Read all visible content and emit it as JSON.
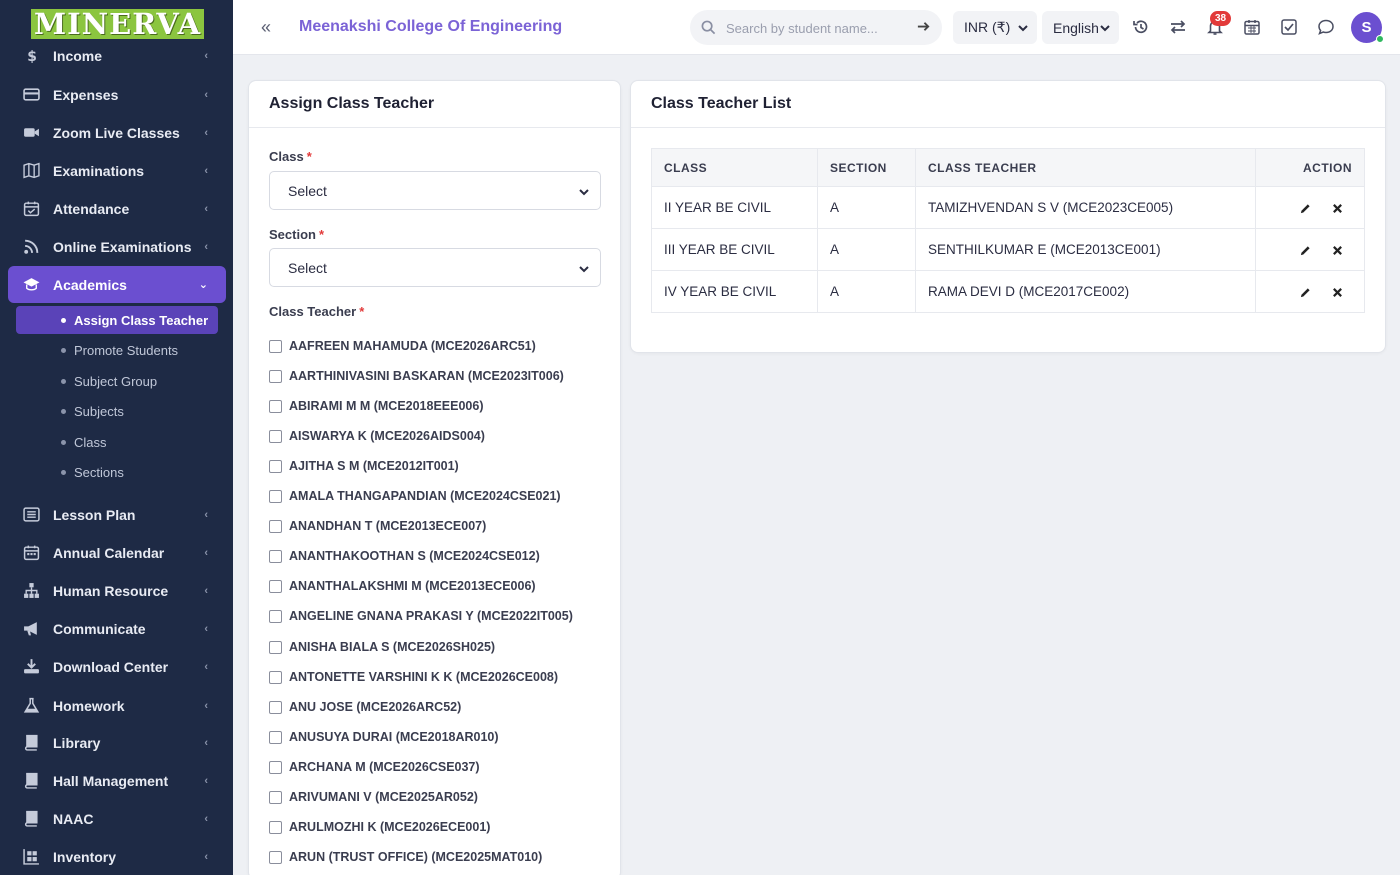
{
  "sidebar": {
    "logo": "MINERVA",
    "items": [
      {
        "label": "Income",
        "icon": "dollar-icon"
      },
      {
        "label": "Expenses",
        "icon": "credit-card-icon"
      },
      {
        "label": "Zoom Live Classes",
        "icon": "video-icon"
      },
      {
        "label": "Examinations",
        "icon": "map-icon"
      },
      {
        "label": "Attendance",
        "icon": "calendar-check-icon"
      },
      {
        "label": "Online Examinations",
        "icon": "rss-icon"
      },
      {
        "label": "Academics",
        "icon": "graduation-cap-icon"
      },
      {
        "label": "Lesson Plan",
        "icon": "list-icon"
      },
      {
        "label": "Annual Calendar",
        "icon": "calendar-icon"
      },
      {
        "label": "Human Resource",
        "icon": "sitemap-icon"
      },
      {
        "label": "Communicate",
        "icon": "bullhorn-icon"
      },
      {
        "label": "Download Center",
        "icon": "download-icon"
      },
      {
        "label": "Homework",
        "icon": "flask-icon"
      },
      {
        "label": "Library",
        "icon": "book-icon"
      },
      {
        "label": "Hall Management",
        "icon": "book-open-icon"
      },
      {
        "label": "NAAC",
        "icon": "book-icon"
      },
      {
        "label": "Inventory",
        "icon": "boxes-icon"
      }
    ],
    "academics_sub": [
      {
        "label": "Assign Class Teacher",
        "active": true
      },
      {
        "label": "Promote Students"
      },
      {
        "label": "Subject Group"
      },
      {
        "label": "Subjects"
      },
      {
        "label": "Class"
      },
      {
        "label": "Sections"
      }
    ]
  },
  "header": {
    "college": "Meenakshi College Of Engineering",
    "search_placeholder": "Search by student name...",
    "currency": "INR (₹)",
    "language": "English",
    "notification_count": "38",
    "avatar": "S"
  },
  "assign_form": {
    "title": "Assign Class Teacher",
    "class_label": "Class",
    "class_value": "Select",
    "section_label": "Section",
    "section_value": "Select",
    "teacher_label": "Class Teacher",
    "required_mark": "*",
    "teachers": [
      "AAFREEN MAHAMUDA (MCE2026ARC51)",
      "AARTHINIVASINI BASKARAN (MCE2023IT006)",
      "ABIRAMI M M (MCE2018EEE006)",
      "AISWARYA K (MCE2026AIDS004)",
      "AJITHA S M (MCE2012IT001)",
      "AMALA THANGAPANDIAN (MCE2024CSE021)",
      "ANANDHAN T (MCE2013ECE007)",
      "ANANTHAKOOTHAN S (MCE2024CSE012)",
      "ANANTHALAKSHMI M (MCE2013ECE006)",
      "ANGELINE GNANA PRAKASI Y (MCE2022IT005)",
      "ANISHA BIALA S (MCE2026SH025)",
      "ANTONETTE VARSHINI K K (MCE2026CE008)",
      "ANU JOSE (MCE2026ARC52)",
      "ANUSUYA DURAI (MCE2018AR010)",
      "ARCHANA M (MCE2026CSE037)",
      "ARIVUMANI V (MCE2025AR052)",
      "ARULMOZHI K (MCE2026ECE001)",
      "ARUN (TRUST OFFICE) (MCE2025MAT010)"
    ]
  },
  "teacher_list": {
    "title": "Class Teacher List",
    "columns": [
      "CLASS",
      "SECTION",
      "CLASS TEACHER",
      "ACTION"
    ],
    "rows": [
      {
        "class": "II YEAR BE CIVIL",
        "section": "A",
        "teacher": "TAMIZHVENDAN S V (MCE2023CE005)"
      },
      {
        "class": "III YEAR BE CIVIL",
        "section": "A",
        "teacher": "SENTHILKUMAR E (MCE2013CE001)"
      },
      {
        "class": "IV YEAR BE CIVIL",
        "section": "A",
        "teacher": "RAMA DEVI D (MCE2017CE002)"
      }
    ]
  }
}
